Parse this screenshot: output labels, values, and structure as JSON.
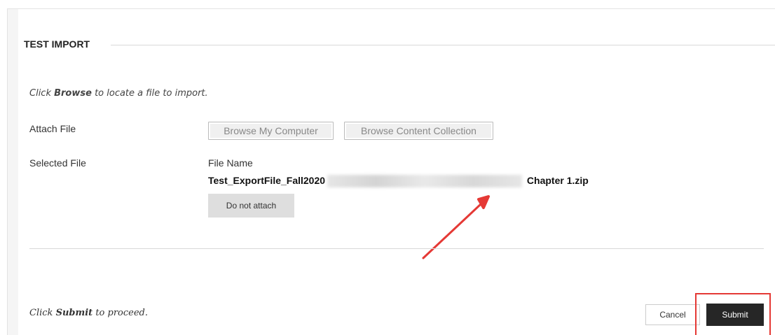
{
  "section": {
    "title": "TEST IMPORT"
  },
  "instruction": {
    "prefix": "Click ",
    "emph": "Browse",
    "suffix": " to locate a file to import."
  },
  "attach": {
    "label": "Attach File",
    "browse_computer": "Browse My Computer",
    "browse_collection": "Browse Content Collection"
  },
  "selected": {
    "label": "Selected File",
    "file_name_header": "File Name",
    "file_name_start": "Test_ExportFile_Fall2020",
    "file_name_end": " Chapter 1.zip",
    "do_not_attach": "Do not attach"
  },
  "submit_instruction": {
    "prefix": "Click ",
    "emph": "Submit",
    "suffix": " to proceed."
  },
  "actions": {
    "cancel": "Cancel",
    "submit": "Submit"
  },
  "colors": {
    "annotation": "#e53935",
    "submit_bg": "#262626"
  }
}
